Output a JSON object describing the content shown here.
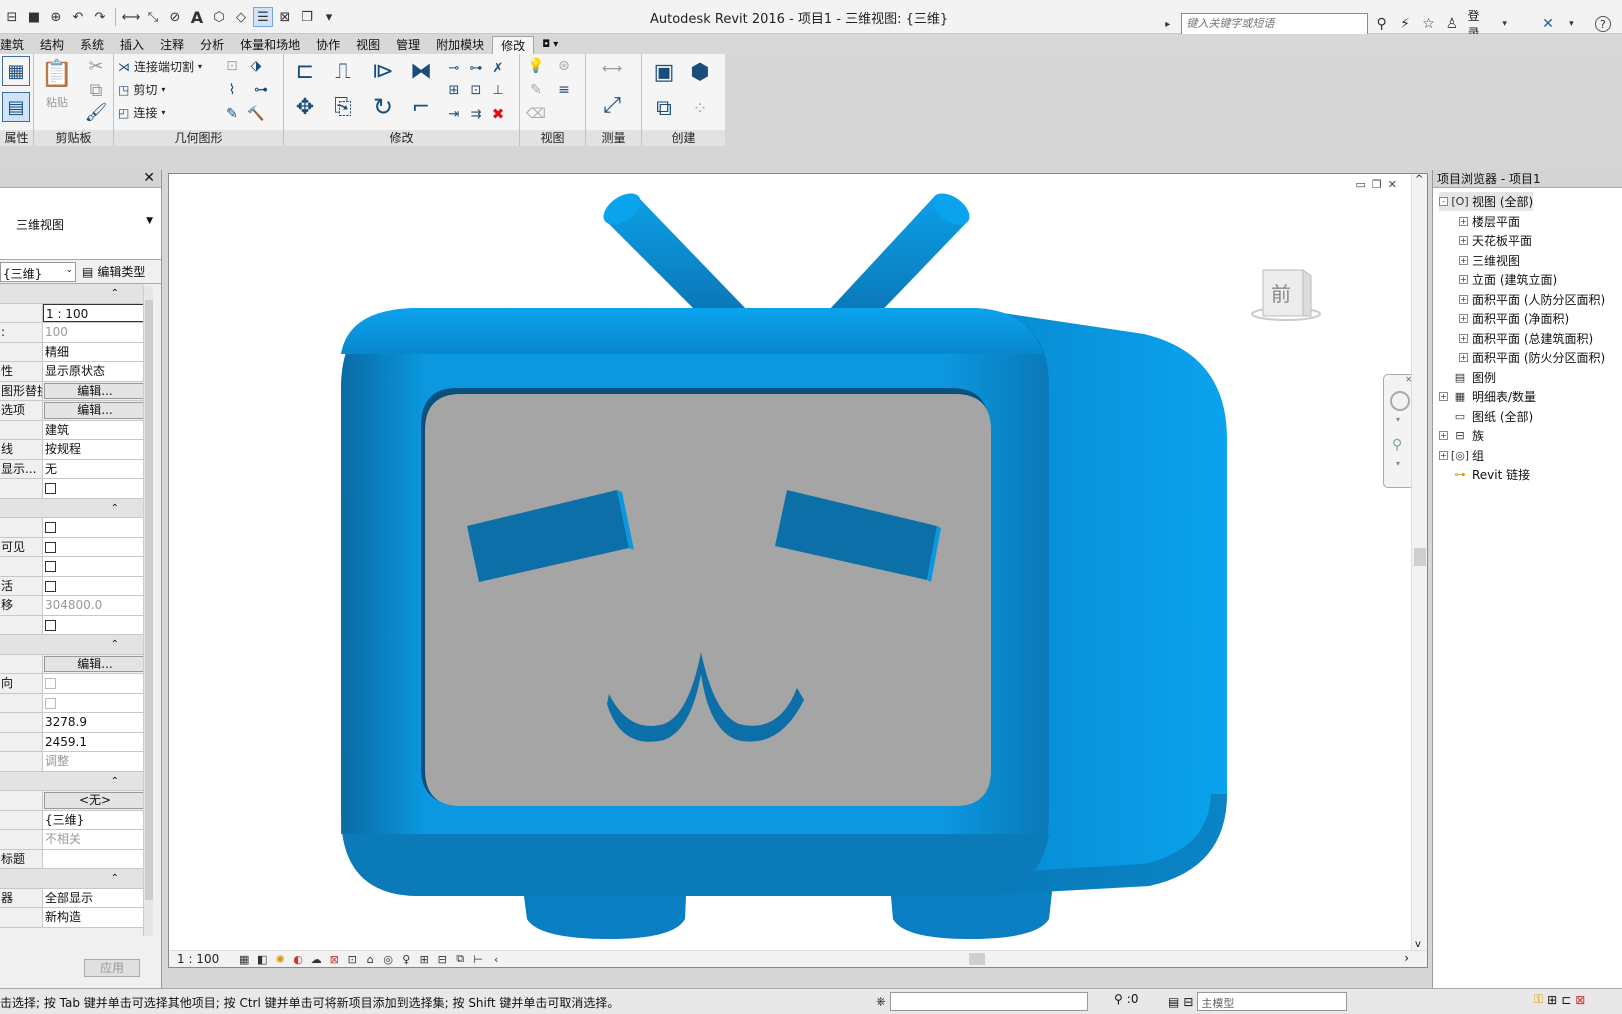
{
  "title_bar": {
    "app_title": "Autodesk Revit 2016 -     项目1 - 三维视图: {三维}",
    "search_placeholder": "键入关键字或短语",
    "login_label": "登录",
    "help_icon": "?"
  },
  "ribbon_tabs": [
    {
      "label": "建筑"
    },
    {
      "label": "结构"
    },
    {
      "label": "系统"
    },
    {
      "label": "插入"
    },
    {
      "label": "注释"
    },
    {
      "label": "分析"
    },
    {
      "label": "体量和场地"
    },
    {
      "label": "协作"
    },
    {
      "label": "视图"
    },
    {
      "label": "管理"
    },
    {
      "label": "附加模块"
    },
    {
      "label": "修改"
    }
  ],
  "ribbon_groups": {
    "properties": "属性",
    "clipboard": "剪贴板",
    "paste": "粘贴",
    "geometry": "几何图形",
    "cope": "连接端切割",
    "cut": "剪切",
    "join": "连接",
    "modify": "修改",
    "view": "视图",
    "measure": "测量",
    "create": "创建"
  },
  "properties_panel": {
    "type_name": "三维视图",
    "instance_selector": "{三维}",
    "edit_type_label": "编辑类型",
    "rows": [
      {
        "key": "",
        "value": "",
        "kind": "section"
      },
      {
        "key": "",
        "value": "1 : 100",
        "kind": "selected"
      },
      {
        "key": ":",
        "value": "100",
        "kind": "grey"
      },
      {
        "key": "",
        "value": "精细",
        "kind": "text"
      },
      {
        "key": "性",
        "value": "显示原状态",
        "kind": "text"
      },
      {
        "key": "图形替换",
        "value": "编辑...",
        "kind": "button"
      },
      {
        "key": "选项",
        "value": "编辑...",
        "kind": "button"
      },
      {
        "key": "",
        "value": "建筑",
        "kind": "text"
      },
      {
        "key": "线",
        "value": "按规程",
        "kind": "text"
      },
      {
        "key": "显示...",
        "value": "无",
        "kind": "text"
      },
      {
        "key": "",
        "value": "",
        "kind": "check"
      },
      {
        "key": "",
        "value": "",
        "kind": "section"
      },
      {
        "key": "",
        "value": "",
        "kind": "check"
      },
      {
        "key": "可见",
        "value": "",
        "kind": "check"
      },
      {
        "key": "",
        "value": "",
        "kind": "check"
      },
      {
        "key": "活",
        "value": "",
        "kind": "check"
      },
      {
        "key": "移",
        "value": "304800.0",
        "kind": "grey"
      },
      {
        "key": "",
        "value": "",
        "kind": "check"
      },
      {
        "key": "",
        "value": "",
        "kind": "section"
      },
      {
        "key": "",
        "value": "编辑...",
        "kind": "button"
      },
      {
        "key": "向",
        "value": "",
        "kind": "check-disabled"
      },
      {
        "key": "",
        "value": "",
        "kind": "check-disabled"
      },
      {
        "key": "",
        "value": "3278.9",
        "kind": "text"
      },
      {
        "key": "",
        "value": "2459.1",
        "kind": "text"
      },
      {
        "key": "",
        "value": "调整",
        "kind": "grey"
      },
      {
        "key": "",
        "value": "",
        "kind": "section"
      },
      {
        "key": "",
        "value": "<无>",
        "kind": "button"
      },
      {
        "key": "",
        "value": "{三维}",
        "kind": "text"
      },
      {
        "key": "",
        "value": "不相关",
        "kind": "grey"
      },
      {
        "key": "标题",
        "value": "",
        "kind": "text"
      },
      {
        "key": "",
        "value": "",
        "kind": "section"
      },
      {
        "key": "器",
        "value": "全部显示",
        "kind": "text"
      },
      {
        "key": "",
        "value": "新构造",
        "kind": "text"
      }
    ],
    "apply_label": "应用"
  },
  "canvas": {
    "viewcube_label": "前",
    "scale_label": "1 : 100",
    "model_colors": {
      "body": "#0b98e0",
      "body_dark": "#0a5a8c",
      "screen": "#a5a5a5",
      "feature": "#0c6fa8"
    }
  },
  "project_browser": {
    "title": "项目浏览器 - 项目1",
    "items": [
      {
        "label": "视图 (全部)",
        "level": 0,
        "toggle": "-",
        "icon": "views-icon",
        "selected": true
      },
      {
        "label": "楼层平面",
        "level": 1,
        "toggle": "+"
      },
      {
        "label": "天花板平面",
        "level": 1,
        "toggle": "+"
      },
      {
        "label": "三维视图",
        "level": 1,
        "toggle": "+"
      },
      {
        "label": "立面 (建筑立面)",
        "level": 1,
        "toggle": "+"
      },
      {
        "label": "面积平面 (人防分区面积)",
        "level": 1,
        "toggle": "+"
      },
      {
        "label": "面积平面 (净面积)",
        "level": 1,
        "toggle": "+"
      },
      {
        "label": "面积平面 (总建筑面积)",
        "level": 1,
        "toggle": "+"
      },
      {
        "label": "面积平面 (防火分区面积)",
        "level": 1,
        "toggle": "+"
      },
      {
        "label": "图例",
        "level": 0,
        "toggle": "",
        "icon": "legend-icon"
      },
      {
        "label": "明细表/数量",
        "level": 0,
        "toggle": "+",
        "icon": "schedule-icon"
      },
      {
        "label": "图纸 (全部)",
        "level": 0,
        "toggle": "",
        "icon": "sheet-icon"
      },
      {
        "label": "族",
        "level": 0,
        "toggle": "+",
        "icon": "family-icon"
      },
      {
        "label": "组",
        "level": 0,
        "toggle": "+",
        "icon": "group-icon"
      },
      {
        "label": "Revit 链接",
        "level": 0,
        "toggle": "",
        "icon": "link-icon"
      }
    ]
  },
  "status_bar": {
    "message": "击选择; 按 Tab 键并单击可选择其他项目; 按 Ctrl 键并单击可将新项目添加到选择集; 按 Shift 键并单击可取消选择。",
    "count": ":0",
    "model_label": "主模型"
  }
}
